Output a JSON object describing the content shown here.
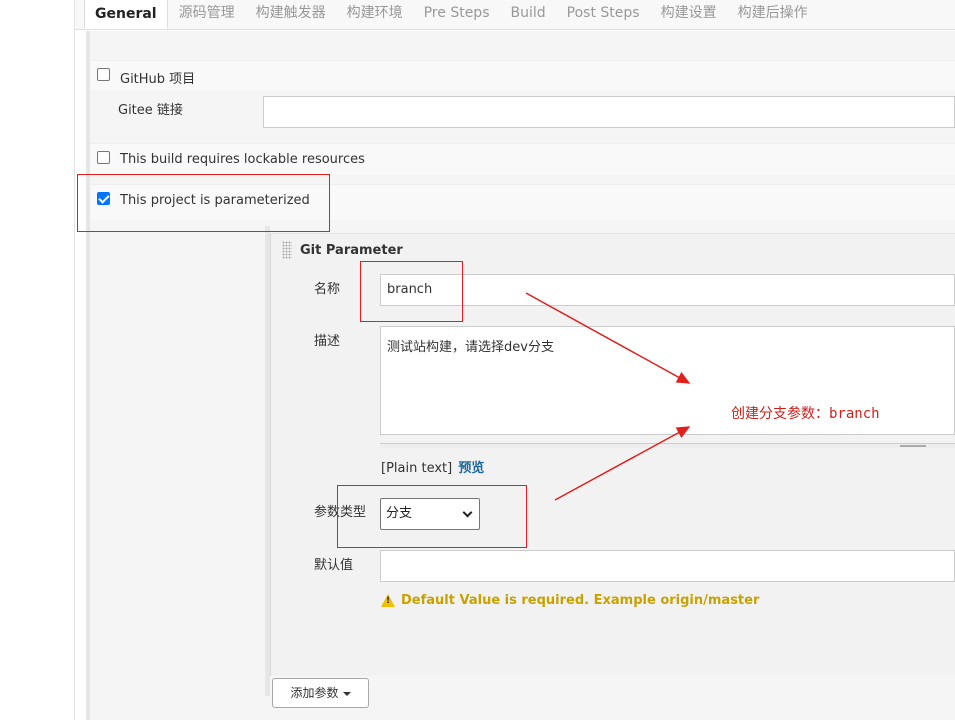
{
  "tabs": [
    {
      "label": "General",
      "active": true
    },
    {
      "label": "源码管理"
    },
    {
      "label": "构建触发器"
    },
    {
      "label": "构建环境"
    },
    {
      "label": "Pre Steps"
    },
    {
      "label": "Build"
    },
    {
      "label": "Post Steps"
    },
    {
      "label": "构建设置"
    },
    {
      "label": "构建后操作"
    }
  ],
  "general": {
    "github_project": {
      "label": "GitHub 项目",
      "checked": false
    },
    "gitee_link": {
      "label": "Gitee 链接",
      "value": ""
    },
    "lockable": {
      "label": "This build requires lockable resources",
      "checked": false
    },
    "parameterized": {
      "label": "This project is parameterized",
      "checked": true
    }
  },
  "git_parameter": {
    "title": "Git Parameter",
    "name_label": "名称",
    "name_value": "branch",
    "desc_label": "描述",
    "desc_value": "测试站构建，请选择dev分支",
    "plain_text": "[Plain text]",
    "preview": "预览",
    "type_label": "参数类型",
    "type_value": "分支",
    "default_label": "默认值",
    "default_value": "",
    "warning": "Default Value is required. Example origin/master"
  },
  "add_param_button": "添加参数",
  "annotation": {
    "text": "创建分支参数：branch",
    "color": "#d0201c"
  },
  "colors": {
    "accent_blue": "#0075ff",
    "link_blue": "#1e6a9c",
    "warning": "#c9a200",
    "highlight_red": "#e0201c"
  }
}
